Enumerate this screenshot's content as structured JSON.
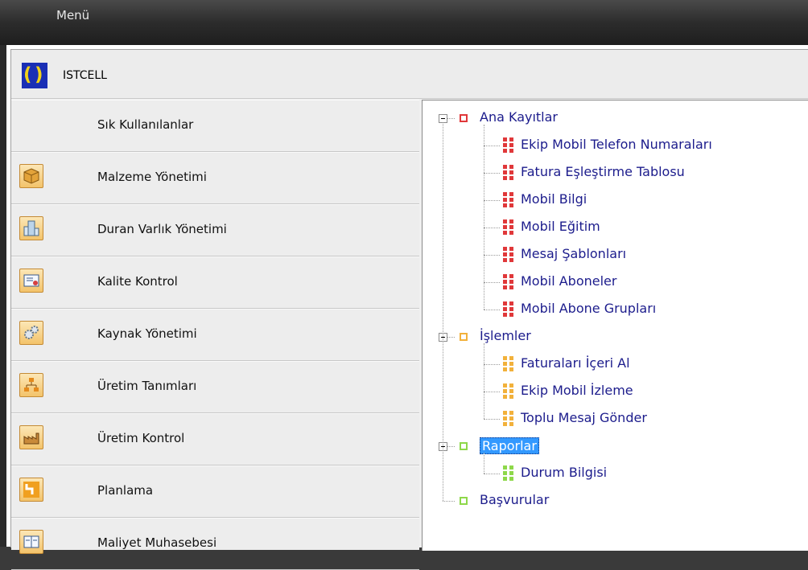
{
  "window": {
    "title": "Menü"
  },
  "brand": {
    "name": "ISTCELL"
  },
  "nav": {
    "items": [
      {
        "label": "Sık Kullanılanlar",
        "icon": "none"
      },
      {
        "label": "Malzeme Yönetimi",
        "icon": "box-icon"
      },
      {
        "label": "Duran Varlık Yönetimi",
        "icon": "building-icon"
      },
      {
        "label": "Kalite Kontrol",
        "icon": "certificate-icon"
      },
      {
        "label": "Kaynak Yönetimi",
        "icon": "gears-icon"
      },
      {
        "label": "Üretim Tanımları",
        "icon": "flowchart-icon"
      },
      {
        "label": "Üretim Kontrol",
        "icon": "factory-icon"
      },
      {
        "label": "Planlama",
        "icon": "planning-icon"
      },
      {
        "label": "Maliyet Muhasebesi",
        "icon": "ledger-icon"
      }
    ]
  },
  "tree": {
    "colors": {
      "red": "#e0383a",
      "orange": "#f2b13b",
      "green": "#8ed84a",
      "selection": "#3399ff"
    },
    "groups": [
      {
        "label": "Ana Kayıtlar",
        "color": "red",
        "children": [
          "Ekip Mobil Telefon Numaraları",
          "Fatura Eşleştirme Tablosu",
          "Mobil Bilgi",
          "Mobil Eğitim",
          "Mesaj Şablonları",
          "Mobil Aboneler",
          "Mobil Abone Grupları"
        ]
      },
      {
        "label": "İşlemler",
        "color": "orange",
        "children": [
          "Faturaları İçeri Al",
          "Ekip Mobil İzleme",
          "Toplu Mesaj Gönder"
        ]
      },
      {
        "label": "Raporlar",
        "color": "green",
        "selected": true,
        "children": [
          "Durum Bilgisi"
        ]
      },
      {
        "label": "Başvurular",
        "color": "green",
        "children": []
      }
    ]
  }
}
